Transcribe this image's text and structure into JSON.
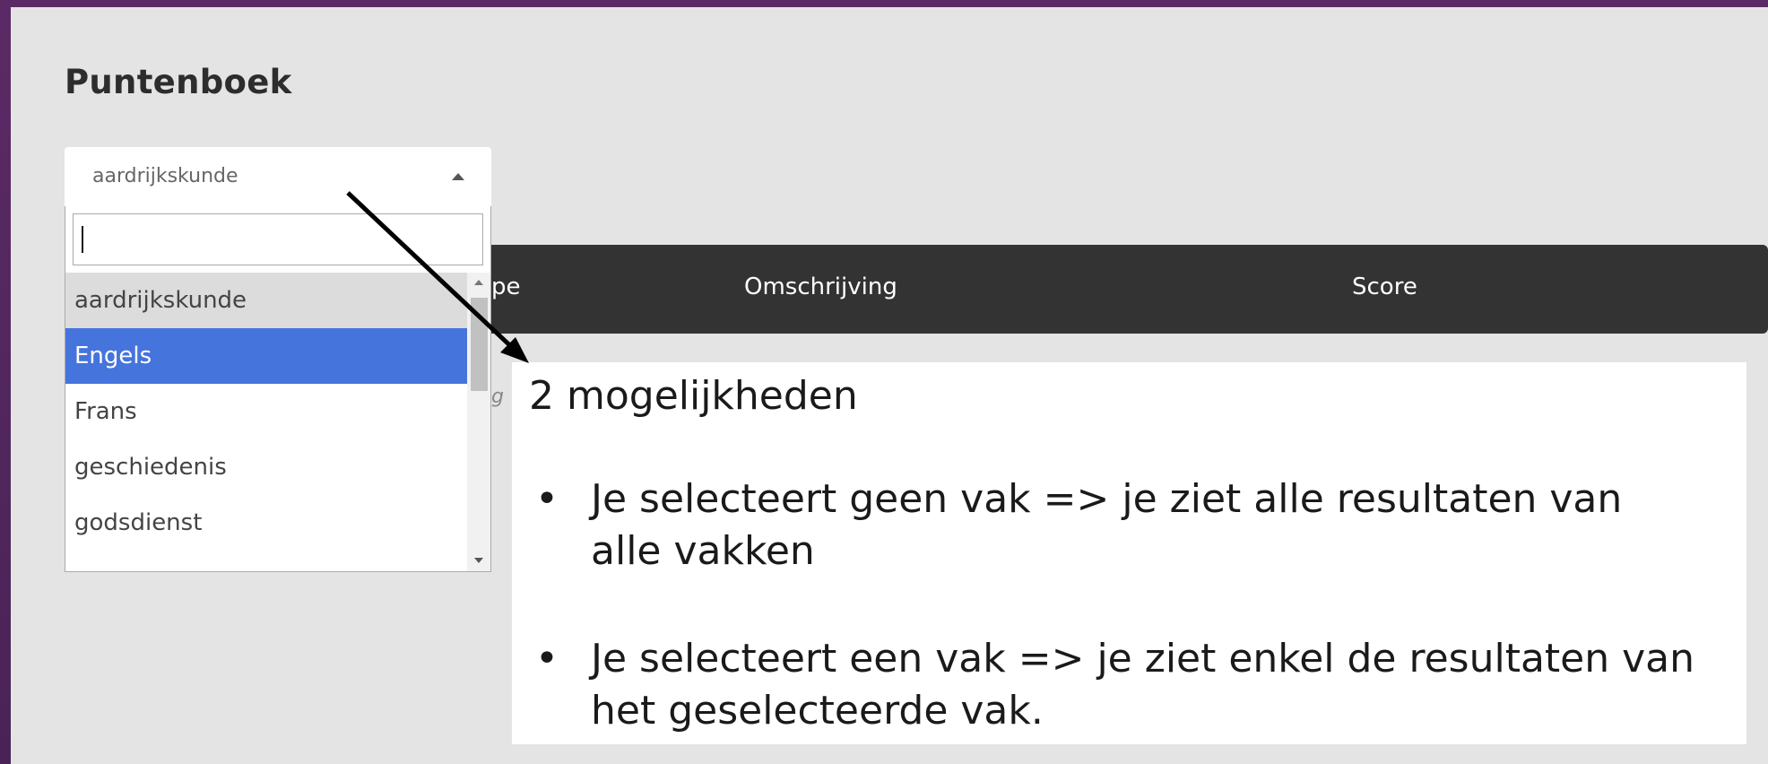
{
  "page": {
    "title": "Puntenboek"
  },
  "subject_select": {
    "selected": "aardrijkskunde",
    "search_value": "",
    "options": [
      "aardrijkskunde",
      "Engels",
      "Frans",
      "geschiedenis",
      "godsdienst"
    ],
    "highlighted_option": "Engels"
  },
  "table": {
    "columns": [
      "pe",
      "Omschrijving",
      "Score"
    ],
    "obscured_text": "g"
  },
  "callout": {
    "title": "2 mogelijkheden",
    "bullet_symbol": "•",
    "bullets": [
      "Je selecteert geen vak => je ziet alle resultaten van alle vakken",
      "Je selecteert een vak => je ziet enkel de resultaten van het geselecteerde vak."
    ]
  },
  "colors": {
    "frame": "#5b2a66",
    "panel": "#e4e4e4",
    "header": "#333333",
    "highlight": "#4574dc"
  }
}
